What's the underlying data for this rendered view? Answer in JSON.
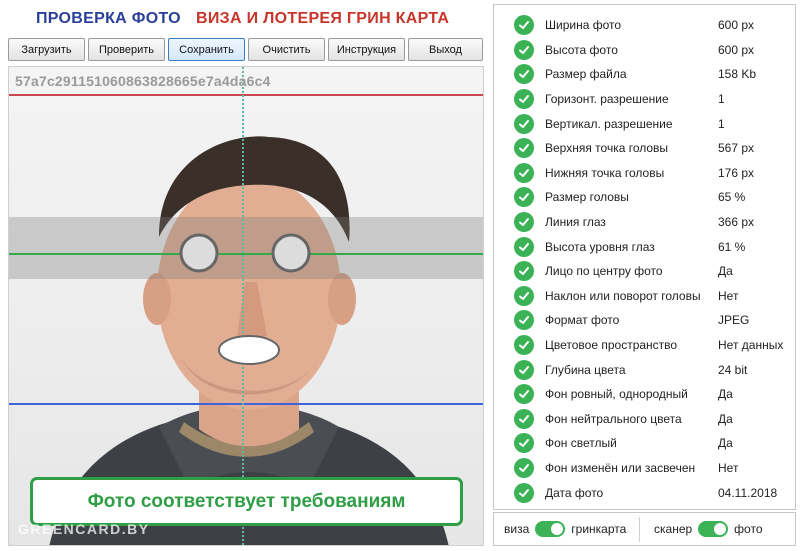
{
  "header": {
    "title_left": "ПРОВЕРКА ФОТО",
    "title_right": "ВИЗА И ЛОТЕРЕЯ ГРИН КАРТА"
  },
  "toolbar": {
    "buttons": [
      {
        "label": "Загрузить"
      },
      {
        "label": "Проверить"
      },
      {
        "label": "Сохранить",
        "active": true
      },
      {
        "label": "Очистить"
      },
      {
        "label": "Инструкция"
      },
      {
        "label": "Выход"
      }
    ]
  },
  "photo": {
    "hash": "57a7c291151060863828665e7a4da6c4",
    "status": "Фото соответствует требованиям",
    "watermark": "GREENCARD.BY"
  },
  "checks": [
    {
      "label": "Ширина фото",
      "value": "600 px"
    },
    {
      "label": "Высота фото",
      "value": "600 px"
    },
    {
      "label": "Размер файла",
      "value": "158 Kb"
    },
    {
      "label": "Горизонт. разрешение",
      "value": "1"
    },
    {
      "label": "Вертикал. разрешение",
      "value": "1"
    },
    {
      "label": "Верхняя точка головы",
      "value": "567 px"
    },
    {
      "label": "Нижняя точка головы",
      "value": "176 px"
    },
    {
      "label": "Размер головы",
      "value": "65 %"
    },
    {
      "label": "Линия глаз",
      "value": "366 px"
    },
    {
      "label": "Высота уровня глаз",
      "value": "61 %"
    },
    {
      "label": "Лицо по центру фото",
      "value": "Да"
    },
    {
      "label": "Наклон или поворот головы",
      "value": "Нет"
    },
    {
      "label": "Формат фото",
      "value": "JPEG"
    },
    {
      "label": "Цветовое пространство",
      "value": "Нет данных"
    },
    {
      "label": "Глубина цвета",
      "value": "24 bit"
    },
    {
      "label": "Фон ровный, однородный",
      "value": "Да"
    },
    {
      "label": "Фон нейтрального цвета",
      "value": "Да"
    },
    {
      "label": "Фон светлый",
      "value": "Да"
    },
    {
      "label": "Фон изменён или засвечен",
      "value": "Нет"
    },
    {
      "label": "Дата фото",
      "value": "04.11.2018"
    }
  ],
  "footer": {
    "toggle1": {
      "left": "виза",
      "right": "гринкарта",
      "on": true
    },
    "toggle2": {
      "left": "сканер",
      "right": "фото",
      "on": true
    }
  },
  "colors": {
    "accent_green": "#3cb257",
    "title_blue": "#2a3f9a",
    "title_red": "#c8352a"
  }
}
